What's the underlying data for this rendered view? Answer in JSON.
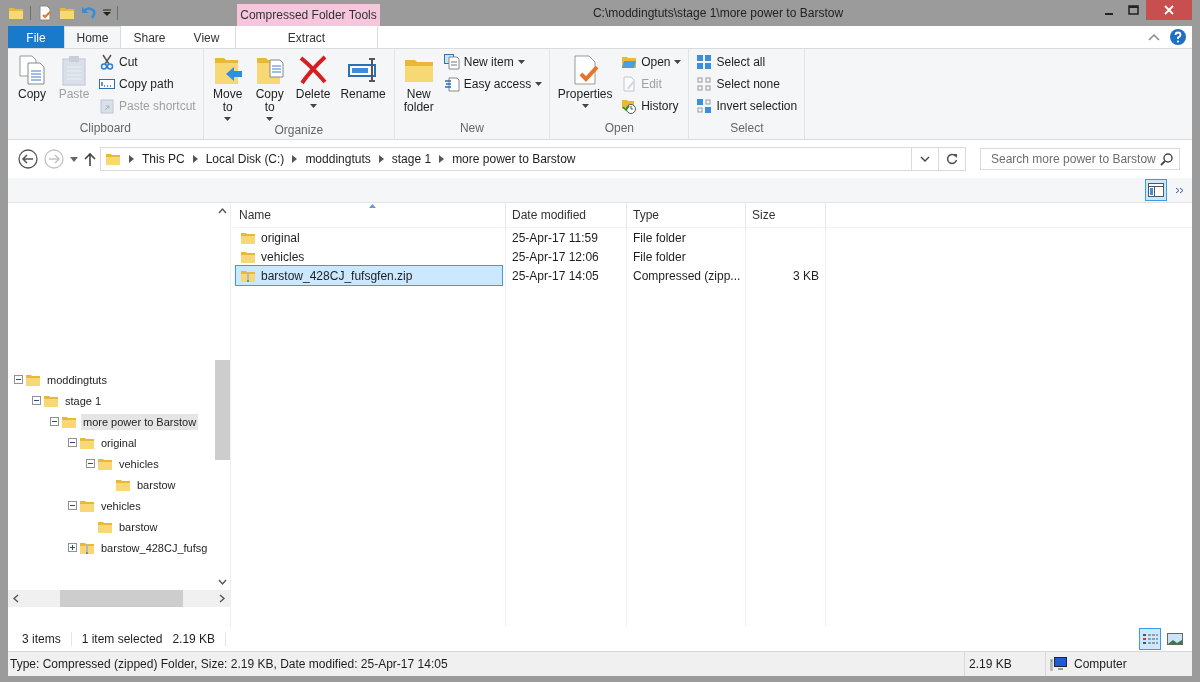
{
  "title_bar": {
    "title": "C:\\moddingtuts\\stage 1\\more power to Barstow",
    "context_tab": "Compressed Folder Tools"
  },
  "ribbon_tabs": [
    {
      "label": "File",
      "kind": "file",
      "selected": false
    },
    {
      "label": "Home",
      "kind": "normal",
      "selected": true
    },
    {
      "label": "Share",
      "kind": "normal",
      "selected": false
    },
    {
      "label": "View",
      "kind": "normal",
      "selected": false
    },
    {
      "label": "Extract",
      "kind": "context",
      "selected": false
    }
  ],
  "ribbon_groups": [
    {
      "label": "Clipboard",
      "buttons": [
        {
          "label": "Copy",
          "kind": "large",
          "disabled": false,
          "dropdown": false
        },
        {
          "label": "Paste",
          "kind": "large",
          "disabled": true,
          "dropdown": false
        },
        {
          "label": "Cut",
          "kind": "small",
          "disabled": false,
          "dropdown": false
        },
        {
          "label": "Copy path",
          "kind": "small",
          "disabled": false,
          "dropdown": false
        },
        {
          "label": "Paste shortcut",
          "kind": "small",
          "disabled": true,
          "dropdown": false
        }
      ]
    },
    {
      "label": "Organize",
      "buttons": [
        {
          "label": "Move to",
          "kind": "large",
          "disabled": false,
          "dropdown": true
        },
        {
          "label": "Copy to",
          "kind": "large",
          "disabled": false,
          "dropdown": true
        },
        {
          "label": "Delete",
          "kind": "large",
          "disabled": false,
          "dropdown": true
        },
        {
          "label": "Rename",
          "kind": "large",
          "disabled": false,
          "dropdown": false
        }
      ]
    },
    {
      "label": "New",
      "buttons": [
        {
          "label": "New folder",
          "kind": "large",
          "disabled": false,
          "dropdown": false
        },
        {
          "label": "New item",
          "kind": "small",
          "disabled": false,
          "dropdown": true
        },
        {
          "label": "Easy access",
          "kind": "small",
          "disabled": false,
          "dropdown": true
        }
      ]
    },
    {
      "label": "Open",
      "buttons": [
        {
          "label": "Properties",
          "kind": "large",
          "disabled": false,
          "dropdown": true
        },
        {
          "label": "Open",
          "kind": "small",
          "disabled": false,
          "dropdown": true
        },
        {
          "label": "Edit",
          "kind": "small",
          "disabled": true,
          "dropdown": false
        },
        {
          "label": "History",
          "kind": "small",
          "disabled": false,
          "dropdown": false
        }
      ]
    },
    {
      "label": "Select",
      "buttons": [
        {
          "label": "Select all",
          "kind": "small",
          "disabled": false,
          "dropdown": false
        },
        {
          "label": "Select none",
          "kind": "small",
          "disabled": false,
          "dropdown": false
        },
        {
          "label": "Invert selection",
          "kind": "small",
          "disabled": false,
          "dropdown": false
        }
      ]
    }
  ],
  "address_bar": {
    "crumbs": [
      "This PC",
      "Local Disk (C:)",
      "moddingtuts",
      "stage 1",
      "more power to Barstow"
    ]
  },
  "search": {
    "placeholder": "Search more power to Barstow"
  },
  "preview_pane": {
    "on": true
  },
  "navigation_tree": [
    {
      "label": "moddingtuts",
      "kind": "folder",
      "expanded": true,
      "selected": false,
      "children": [
        {
          "label": "stage 1",
          "kind": "folder",
          "expanded": true,
          "selected": false,
          "children": [
            {
              "label": "more power to Barstow",
              "kind": "folder",
              "expanded": true,
              "selected": true,
              "children": [
                {
                  "label": "original",
                  "kind": "folder",
                  "expanded": true,
                  "selected": false,
                  "children": [
                    {
                      "label": "vehicles",
                      "kind": "folder",
                      "expanded": true,
                      "selected": false,
                      "children": [
                        {
                          "label": "barstow",
                          "kind": "folder",
                          "selected": false
                        }
                      ]
                    }
                  ]
                },
                {
                  "label": "vehicles",
                  "kind": "folder",
                  "expanded": true,
                  "selected": false,
                  "children": [
                    {
                      "label": "barstow",
                      "kind": "folder",
                      "selected": false
                    }
                  ]
                },
                {
                  "label": "barstow_428CJ_fufsg",
                  "kind": "zip",
                  "expanded": false,
                  "selected": false
                }
              ]
            }
          ]
        }
      ]
    }
  ],
  "file_list": {
    "columns": [
      {
        "label": "Name",
        "sorted": true
      },
      {
        "label": "Date modified",
        "sorted": false
      },
      {
        "label": "Type",
        "sorted": false
      },
      {
        "label": "Size",
        "sorted": false
      }
    ],
    "rows": [
      {
        "name": "original",
        "kind": "folder",
        "date": "25-Apr-17 11:59",
        "type": "File folder",
        "size": "",
        "selected": false
      },
      {
        "name": "vehicles",
        "kind": "folder",
        "date": "25-Apr-17 12:06",
        "type": "File folder",
        "size": "",
        "selected": false
      },
      {
        "name": "barstow_428CJ_fufsgfen.zip",
        "kind": "zip",
        "date": "25-Apr-17 14:05",
        "type": "Compressed (zipp...",
        "size": "3 KB",
        "selected": true
      }
    ]
  },
  "status": {
    "item_count": "3 items",
    "selection": "1 item selected",
    "selection_size": "2.19 KB"
  },
  "view_buttons": [
    {
      "selected": true
    },
    {
      "selected": false
    }
  ],
  "details_bar": {
    "text": "Type: Compressed (zipped) Folder, Size: 2.19 KB, Date modified: 25-Apr-17 14:05",
    "size": "2.19 KB",
    "location": "Computer"
  }
}
